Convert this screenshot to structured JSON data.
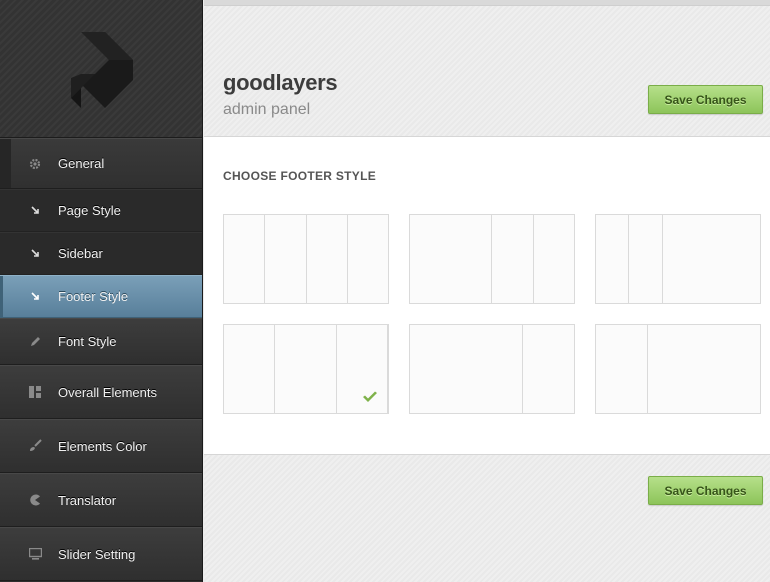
{
  "brand": {
    "title": "goodlayers",
    "subtitle": "admin panel"
  },
  "buttons": {
    "save_top": "Save Changes",
    "save_bottom": "Save Changes"
  },
  "section": {
    "title": "CHOOSE FOOTER STYLE"
  },
  "sidebar": {
    "items": [
      {
        "label": "General",
        "icon": "gear-icon"
      },
      {
        "label": "Page Style",
        "icon": "arrow-down-right-icon"
      },
      {
        "label": "Sidebar",
        "icon": "arrow-down-right-icon"
      },
      {
        "label": "Footer Style",
        "icon": "arrow-down-right-icon",
        "active": true
      },
      {
        "label": "Font Style",
        "icon": "pencil-icon"
      },
      {
        "label": "Overall Elements",
        "icon": "layout-icon"
      },
      {
        "label": "Elements Color",
        "icon": "brush-icon"
      },
      {
        "label": "Translator",
        "icon": "pacman-icon"
      },
      {
        "label": "Slider Setting",
        "icon": "monitor-icon"
      }
    ]
  },
  "footer_styles": [
    {
      "columns": [
        1,
        1,
        1,
        1
      ],
      "selected": false
    },
    {
      "columns": [
        2,
        1,
        1
      ],
      "selected": false
    },
    {
      "columns": [
        1,
        1,
        3
      ],
      "selected": false
    },
    {
      "columns": [
        1,
        1.2,
        1
      ],
      "selected": true
    },
    {
      "columns": [
        2.2,
        1
      ],
      "selected": false
    },
    {
      "columns": [
        1,
        2.2
      ],
      "selected": false
    }
  ],
  "colors": {
    "accent_green": "#8dc45a",
    "active_blue": "#6a91ab",
    "sidebar_dark": "#2e2e2e"
  }
}
